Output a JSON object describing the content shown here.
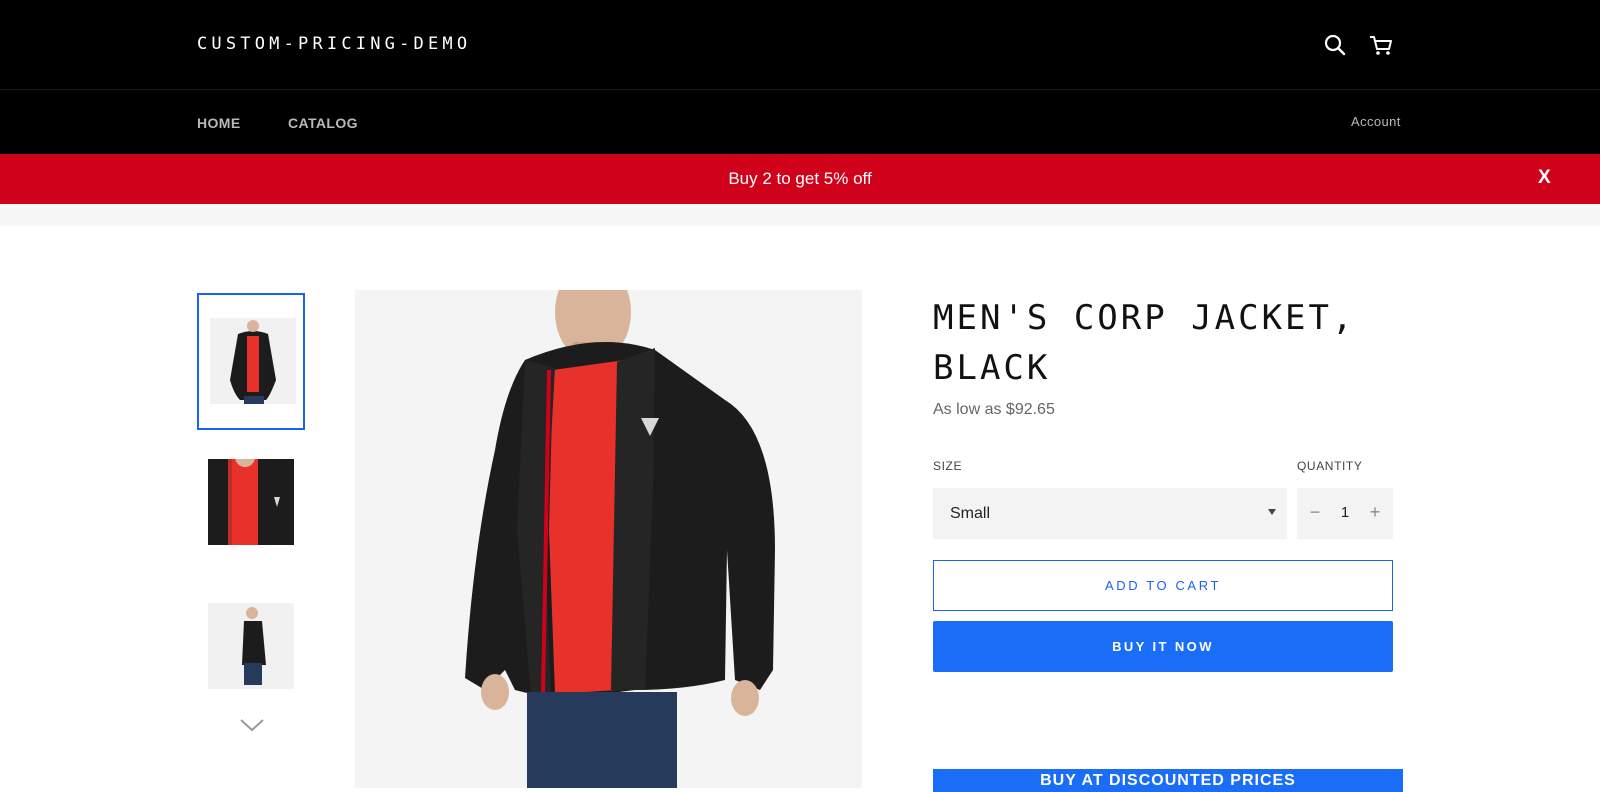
{
  "header": {
    "brand": "CUSTOM-PRICING-DEMO",
    "icons": [
      "search-icon",
      "cart-icon"
    ]
  },
  "nav": {
    "items": [
      {
        "label": "HOME"
      },
      {
        "label": "CATALOG"
      }
    ],
    "account_label": "Account"
  },
  "promo": {
    "text": "Buy 2 to get 5% off",
    "close_label": "X",
    "background": "#d0021b"
  },
  "product": {
    "title": "MEN'S CORP JACKET, BLACK",
    "price": "As low as $92.65",
    "size_label": "SIZE",
    "size_value": "Small",
    "quantity_label": "QUANTITY",
    "quantity_value": "1",
    "quantity_minus": "−",
    "quantity_plus": "+",
    "add_to_cart": "ADD TO CART",
    "buy_now": "BUY IT NOW",
    "discount_button": "BUY AT DISCOUNTED PRICES"
  },
  "colors": {
    "accent": "#1a6df7",
    "header_bg": "#000000"
  }
}
